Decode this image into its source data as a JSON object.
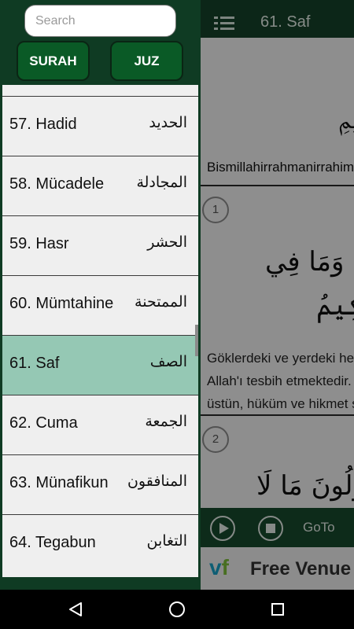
{
  "reader": {
    "title": "61. Saf",
    "bismillah_arabic": "ﭐلرَّحِيمِ",
    "bismillah_latin": "Bismillahirrahmanirrahim",
    "verses": [
      {
        "number": "1",
        "arabic_line1": "ٱلسَّمَٰوَٰتِ وَمَا فِي",
        "arabic_line2": "ٱلۡحَكِيمُ",
        "translation": "Göklerdeki ve yerdeki her şey Allah'ı tesbih etmektedir. O, öyle üstün, hüküm ve hikmet sahibidir."
      },
      {
        "number": "2",
        "arabic_line1": "تَقُولُونَ مَا لَا"
      }
    ]
  },
  "player": {
    "goto_label": "GoTo"
  },
  "ad": {
    "logo_v": "v",
    "logo_f": "f",
    "text": "Free Venue"
  },
  "drawer": {
    "search_placeholder": "Search",
    "tabs": {
      "surah": "SURAH",
      "juz": "JUZ"
    },
    "surahs": [
      {
        "label": "57. Hadid",
        "arabic": "الحديد"
      },
      {
        "label": "58. Mücadele",
        "arabic": "المجادلة"
      },
      {
        "label": "59. Hasr",
        "arabic": "الحشر"
      },
      {
        "label": "60. Mümtahine",
        "arabic": "الممتحنة"
      },
      {
        "label": "61. Saf",
        "arabic": "الصف",
        "selected": true
      },
      {
        "label": "62. Cuma",
        "arabic": "الجمعة"
      },
      {
        "label": "63. Münafikun",
        "arabic": "المنافقون"
      },
      {
        "label": "64. Tegabun",
        "arabic": "التغابن"
      }
    ]
  },
  "colors": {
    "drawer_bg": "#0f3b23",
    "tab_bg": "#0a5a26",
    "selected_row": "#95c8b4",
    "toolbar": "#16432a"
  },
  "icons": {
    "menu": "menu-icon",
    "play": "play-icon",
    "stop": "stop-icon",
    "back": "nav-back-icon",
    "home": "nav-home-icon",
    "recent": "nav-recent-icon"
  }
}
